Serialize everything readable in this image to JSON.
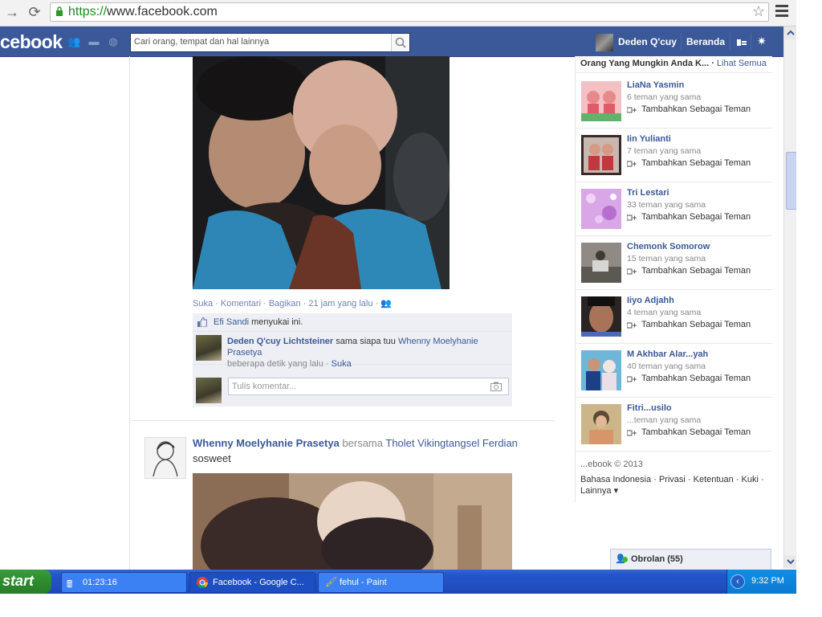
{
  "browser": {
    "url_scheme": "https://",
    "url_rest": "www.facebook.com"
  },
  "fb": {
    "logo": "cebook",
    "search_placeholder": "Cari orang, tempat dan hal lainnya",
    "profile_name": "Deden Q'cuy",
    "home": "Beranda"
  },
  "post1": {
    "actions": {
      "like": "Suka",
      "comment": "Komentari",
      "share": "Bagikan",
      "time": "21 jam yang lalu"
    },
    "liked_name": "Efi Sandi",
    "liked_suffix": "menyukai ini.",
    "comment": {
      "author": "Deden Q'cuy Lichtsteiner",
      "text_mid": "sama siapa tuu",
      "mention": "Whenny Moelyhanie Prasetya",
      "time": "beberapa detik yang lalu",
      "like": "Suka"
    },
    "write_placeholder": "Tulis komentar..."
  },
  "post2": {
    "author": "Whenny Moelyhanie Prasetya",
    "with_word": "bersama",
    "tagged": "Tholet Vikingtangsel Ferdian",
    "body": "sosweet"
  },
  "pymk": {
    "title": "Orang Yang Mungkin Anda K...",
    "see_all": "Lihat Semua",
    "add_label": "Tambahkan Sebagai Teman",
    "people": [
      {
        "name": "LiaNa Yasmin",
        "mutual": "6 teman yang sama"
      },
      {
        "name": "Iin Yulianti",
        "mutual": "7 teman yang sama"
      },
      {
        "name": "Tri Lestari",
        "mutual": "33 teman yang sama"
      },
      {
        "name": "Chemonk Somorow",
        "mutual": "15 teman yang sama"
      },
      {
        "name": "Iiyo Adjahh",
        "mutual": "4 teman yang sama"
      },
      {
        "name": "M Akhbar Alar...yah",
        "mutual": "40 teman yang sama"
      },
      {
        "name": "Fitri...usilo",
        "mutual": "...teman yang sama"
      }
    ]
  },
  "footer": {
    "copyright": "...ebook © 2013",
    "links": "Bahasa Indonesia · Privasi · Ketentuan · Kuki · Lainnya ▾"
  },
  "chat": {
    "label": "Obrolan (55)"
  },
  "taskbar": {
    "start": "start",
    "task1": "01:23:16",
    "task2": "Facebook - Google C...",
    "task3": "fehul - Paint",
    "clock": "9:32 PM"
  }
}
